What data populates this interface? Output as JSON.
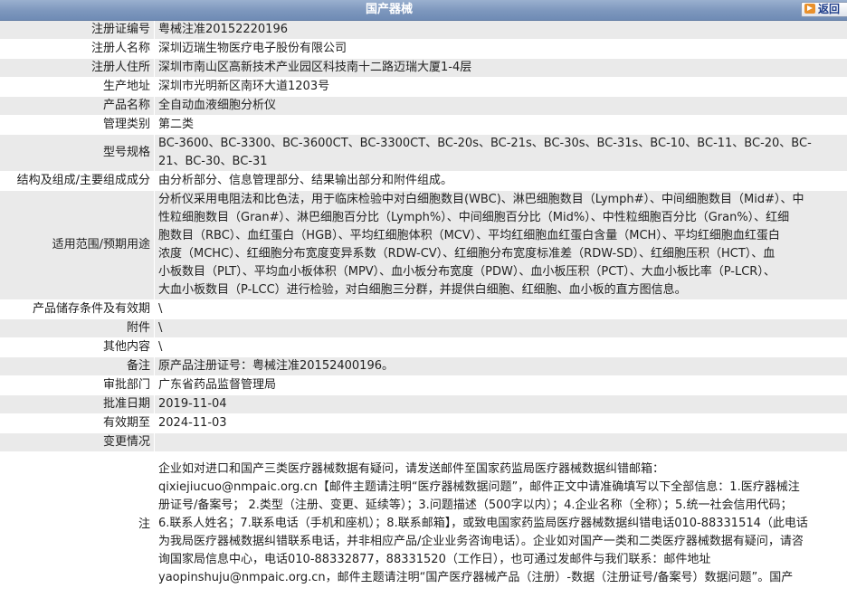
{
  "header": {
    "title": "国产器械",
    "back_label": "返回"
  },
  "rows": [
    {
      "label": "注册证编号",
      "value": "粤械注准20152220196"
    },
    {
      "label": "注册人名称",
      "value": "深圳迈瑞生物医疗电子股份有限公司"
    },
    {
      "label": "注册人住所",
      "value": "深圳市南山区高新技术产业园区科技南十二路迈瑞大厦1-4层"
    },
    {
      "label": "生产地址",
      "value": "深圳市光明新区南环大道1203号"
    },
    {
      "label": "产品名称",
      "value": "全自动血液细胞分析仪"
    },
    {
      "label": "管理类别",
      "value": "第二类"
    },
    {
      "label": "型号规格",
      "value_lines": [
        "BC-3600、BC-3300、BC-3600CT、BC-3300CT、BC-20s、BC-21s、BC-30s、BC-31s、BC-10、BC-11、BC-20、BC-",
        "21、BC-30、BC-31"
      ]
    },
    {
      "label": "结构及组成/主要组成成分",
      "value": "由分析部分、信息管理部分、结果输出部分和附件组成。"
    },
    {
      "label": "适用范围/预期用途",
      "value_lines": [
        "分析仪采用电阻法和比色法，用于临床检验中对白细胞数目(WBC)、淋巴细胞数目（Lymph#）、中间细胞数目（Mid#）、中",
        "性粒细胞数目（Gran#）、淋巴细胞百分比（Lymph%）、中间细胞百分比（Mid%）、中性粒细胞百分比（Gran%）、红细",
        "胞数目（RBC）、血红蛋白（HGB）、平均红细胞体积（MCV）、平均红细胞血红蛋白含量（MCH）、平均红细胞血红蛋白",
        "浓度（MCHC）、红细胞分布宽度变异系数（RDW-CV）、红细胞分布宽度标准差（RDW-SD）、红细胞压积（HCT）、血",
        "小板数目（PLT）、平均血小板体积（MPV）、血小板分布宽度（PDW）、血小板压积（PCT）、大血小板比率（P-LCR）、",
        "大血小板数目（P-LCC）进行检验，对白细胞三分群，并提供白细胞、红细胞、血小板的直方图信息。"
      ]
    },
    {
      "label": "产品储存条件及有效期",
      "value": "\\"
    },
    {
      "label": "附件",
      "value": "\\"
    },
    {
      "label": "其他内容",
      "value": "\\"
    },
    {
      "label": "备注",
      "value": "原产品注册证号：粤械注准20152400196。"
    },
    {
      "label": "审批部门",
      "value": "广东省药品监督管理局"
    },
    {
      "label": "批准日期",
      "value": "2019-11-04"
    },
    {
      "label": "有效期至",
      "value": "2024-11-03"
    },
    {
      "label": "变更情况",
      "value": ""
    },
    {
      "label": "注",
      "value_lines": [
        "企业如对进口和国产三类医疗器械数据有疑问，请发送邮件至国家药监局医疗器械数据纠错邮箱：",
        "qixiejiucuo@nmpaic.org.cn【邮件主题请注明“医疗器械数据问题”，邮件正文中请准确填写以下全部信息：1.医疗器械注",
        "册证号/备案号； 2.类型（注册、变更、延续等）；3.问题描述（500字以内）；4.企业名称（全称）；5.统一社会信用代码；",
        "6.联系人姓名；7.联系电话（手机和座机）；8.联系邮箱】，或致电国家药监局医疗器械数据纠错电话010-88331514（此电话",
        "为我局医疗器械数据纠错联系电话，并非相应产品/企业业务咨询电话）。企业如对国产一类和二类医疗器械数据有疑问，请咨",
        "询国家局信息中心，电话010-88332877，88331520（工作日），也可通过发邮件与我们联系：邮件地址",
        "yaopinshuju@nmpaic.org.cn，邮件主题请注明“国产医疗器械产品（注册）-数据（注册证号/备案号）数据问题”。国产"
      ]
    }
  ]
}
